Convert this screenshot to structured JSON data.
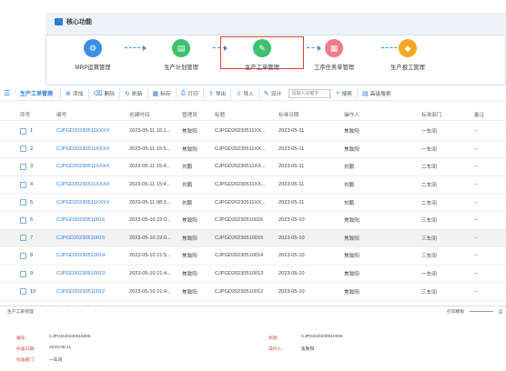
{
  "core": {
    "title": "核心功能",
    "steps": [
      {
        "label": "MRP运算管理",
        "color": "#3d8ee6",
        "glyph": "⚙",
        "icon": "mrp-icon"
      },
      {
        "label": "生产计划管理",
        "color": "#3ec16f",
        "glyph": "▤",
        "icon": "plan-icon"
      },
      {
        "label": "生产工单管理",
        "color": "#3ec16f",
        "glyph": "✎",
        "icon": "work-order-icon"
      },
      {
        "label": "工序任务单管理",
        "color": "#f07c8c",
        "glyph": "▦",
        "icon": "task-icon"
      },
      {
        "label": "生产报工管理",
        "color": "#f5a623",
        "glyph": "◆",
        "icon": "report-icon"
      }
    ]
  },
  "toolbar": {
    "title": "生产工单管理",
    "buttons": [
      {
        "label": "添加",
        "icon": "+"
      },
      {
        "label": "删除",
        "icon": "🗑"
      },
      {
        "label": "刷新",
        "icon": "↻"
      },
      {
        "label": "标存",
        "icon": "▦"
      },
      {
        "label": "打印",
        "icon": "⎙"
      },
      {
        "label": "导出",
        "icon": "⇪"
      },
      {
        "label": "导入",
        "icon": "⇩"
      },
      {
        "label": "设计",
        "icon": "✎"
      }
    ],
    "search_placeholder": "请输入关键字",
    "search_label": "搜索",
    "advanced_label": "高级搜索"
  },
  "table": {
    "headers": [
      "序号",
      "编号",
      "创建时间",
      "管理员",
      "标题",
      "标准日期",
      "操作人",
      "标准部门",
      "备注"
    ],
    "rows": [
      {
        "no": "1",
        "code": "CJPGD20230511XXXX",
        "time": "2023-05-11 16:1...",
        "mgr": "焦致阳",
        "title": "CJPGD20230511XX...",
        "date": "2023-05-11",
        "op": "焦致阳",
        "dept": "一车间",
        "note": "--"
      },
      {
        "no": "2",
        "code": "CJPGD20230511XXXX",
        "time": "2023-05-11 15:5...",
        "mgr": "焦致阳",
        "title": "CJPGD20230511XX...",
        "date": "2023-05-11",
        "op": "焦致阳",
        "dept": "一车间",
        "note": "--"
      },
      {
        "no": "3",
        "code": "CJPGD20230511XXXX",
        "time": "2023-05-11 15:4...",
        "mgr": "刘鹏",
        "title": "CJPGD20230511XX...",
        "date": "2023-05-11",
        "op": "刘鹏",
        "dept": "二车间",
        "note": "--"
      },
      {
        "no": "4",
        "code": "CJPGD20230511XXXX",
        "time": "2023-05-11 15:4...",
        "mgr": "刘鹏",
        "title": "CJPGD20230511XX...",
        "date": "2023-05-11",
        "op": "刘鹏",
        "dept": "二车间",
        "note": "--"
      },
      {
        "no": "5",
        "code": "CJPGD20230511XXXX",
        "time": "2023-05-11 08:3...",
        "mgr": "刘鹏",
        "title": "CJPGD20230511XX...",
        "date": "2023-05-11",
        "op": "刘鹏",
        "dept": "二车间",
        "note": "--"
      },
      {
        "no": "6",
        "code": "CJPGD20230510016",
        "time": "2023-05-10 22:0...",
        "mgr": "焦致阳",
        "title": "CJPGD20230510016",
        "date": "2023-05-10",
        "op": "焦致阳",
        "dept": "三车间",
        "note": "--"
      },
      {
        "no": "7",
        "code": "CJPGD20230510015",
        "time": "2023-05-10 22:0...",
        "mgr": "焦致阳",
        "title": "CJPGD20230510015",
        "date": "2023-05-10",
        "op": "焦致阳",
        "dept": "三车间",
        "note": "--"
      },
      {
        "no": "8",
        "code": "CJPGD20230510014",
        "time": "2023-05-10 21:5...",
        "mgr": "焦致阳",
        "title": "CJPGD20230510014",
        "date": "2023-05-10",
        "op": "焦致阳",
        "dept": "三车间",
        "note": "--"
      },
      {
        "no": "9",
        "code": "CJPGD20230510013",
        "time": "2023-05-10 21:4...",
        "mgr": "焦致阳",
        "title": "CJPGD20230510013",
        "date": "2023-05-10",
        "op": "焦致阳",
        "dept": "一车间",
        "note": "--"
      },
      {
        "no": "10",
        "code": "CJPGD20230510012",
        "time": "2023-05-10 21:4...",
        "mgr": "焦致阳",
        "title": "CJPGD20230510012",
        "date": "2023-05-10",
        "op": "焦致阳",
        "dept": "三车间",
        "note": "--"
      }
    ]
  },
  "detail": {
    "bar_label": "生产工单管理",
    "nav": "‹‹ ‹ › ››",
    "right_label": "打印模板",
    "fields": {
      "code_label": "编号:",
      "code_value": "CJPGD20230510005",
      "date_label": "标准日期:",
      "date_value": "2023-05-11",
      "dept_label": "标准部门:",
      "dept_value": "一车间",
      "title_label": "标题:",
      "title_value": "CJPGD20230510005",
      "op_label": "操作人:",
      "op_value": "焦致阳"
    }
  }
}
